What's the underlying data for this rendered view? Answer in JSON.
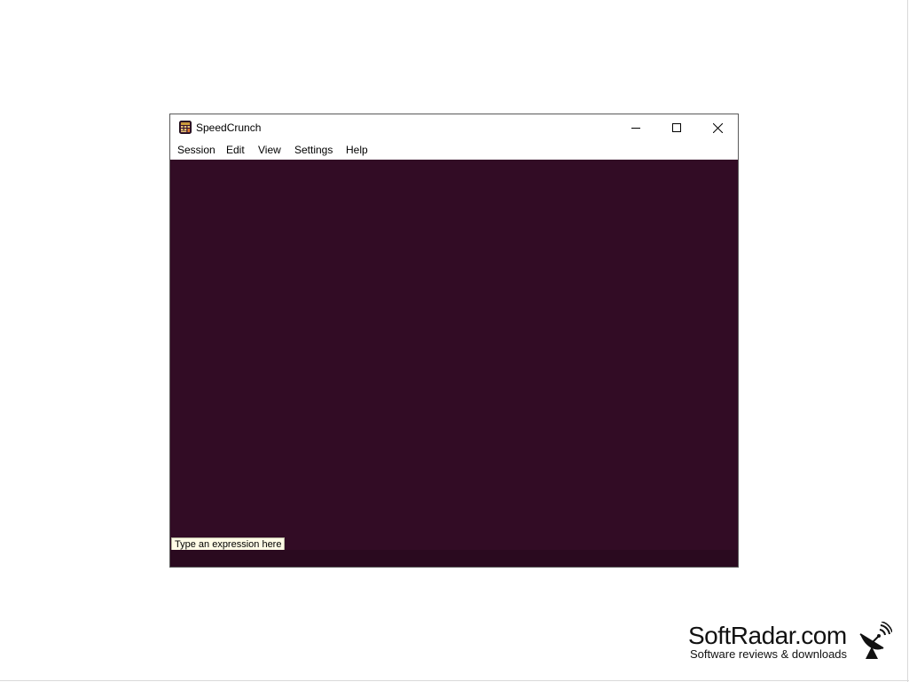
{
  "window": {
    "title": "SpeedCrunch",
    "app_icon": "speedcrunch-app-icon",
    "controls": [
      "minimize-icon",
      "maximize-icon",
      "close-icon"
    ]
  },
  "menubar": {
    "items": [
      {
        "label": "Session"
      },
      {
        "label": "Edit"
      },
      {
        "label": "View"
      },
      {
        "label": "Settings"
      },
      {
        "label": "Help"
      }
    ]
  },
  "editor": {
    "hint": "Type an expression here",
    "value": ""
  },
  "colors": {
    "display_background": "#320c25",
    "input_background": "#2a0a1f",
    "hint_background": "#fffbe6"
  },
  "watermark": {
    "brand": "SoftRadar.com",
    "tagline": "Software reviews & downloads",
    "icon": "satellite-dish-icon"
  }
}
